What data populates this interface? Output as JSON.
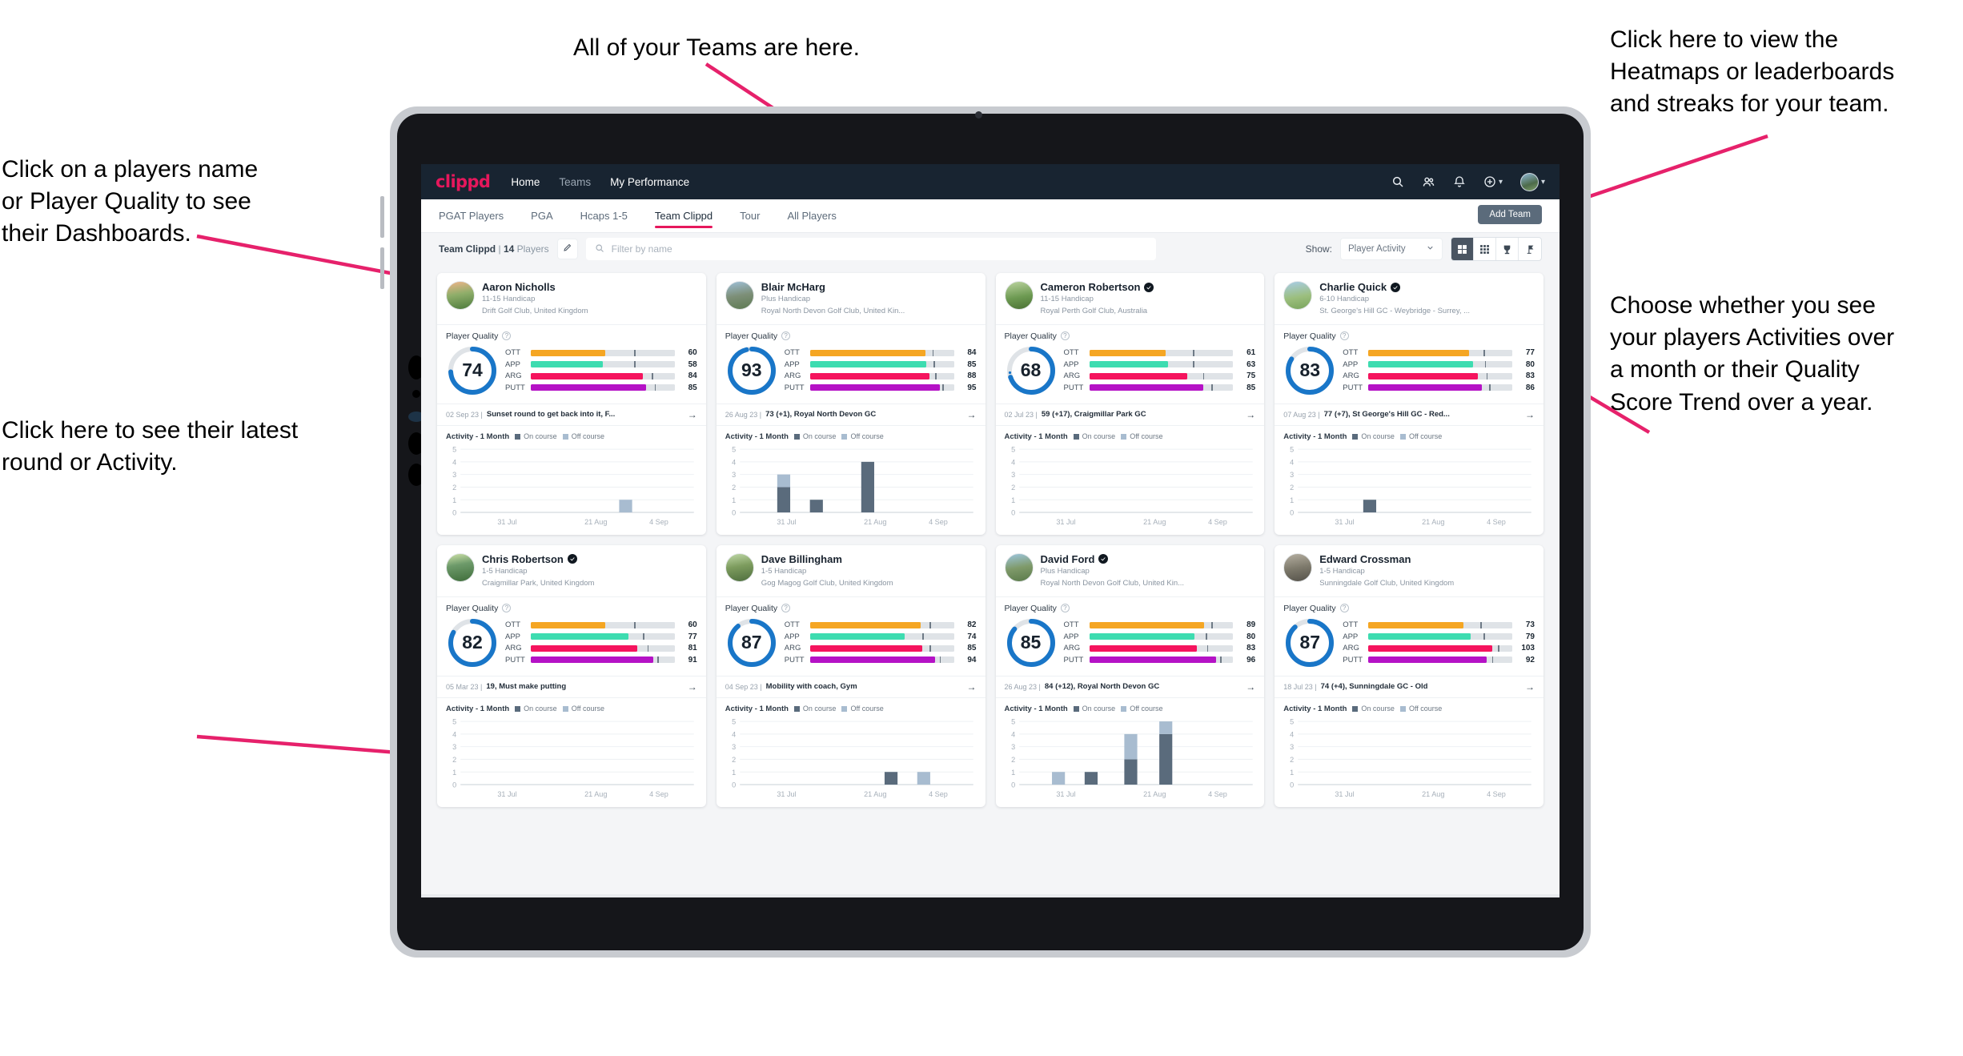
{
  "annotations": [
    {
      "id": "teams-callout",
      "text": "All of your Teams are here."
    },
    {
      "id": "heatmaps-callout",
      "text": "Click here to view the\nHeatmaps or leaderboards\nand streaks for your team."
    },
    {
      "id": "player-name-callout",
      "text": "Click on a players name\nor Player Quality to see\ntheir Dashboards."
    },
    {
      "id": "activity-toggle-callout",
      "text": "Choose whether you see\nyour players Activities over\na month or their Quality\nScore Trend over a year."
    },
    {
      "id": "latest-round-callout",
      "text": "Click here to see their latest\nround or Activity."
    }
  ],
  "app": {
    "brand": "clippd",
    "nav_links": [
      {
        "label": "Home",
        "active": true
      },
      {
        "label": "Teams",
        "active": false
      },
      {
        "label": "My Performance",
        "active": true
      }
    ],
    "nav_icons": [
      "search-icon",
      "people-icon",
      "bell-icon",
      "plus-circle-icon",
      "avatar"
    ],
    "tabs": [
      {
        "label": "PGAT Players",
        "active": false
      },
      {
        "label": "PGA",
        "active": false
      },
      {
        "label": "Hcaps 1-5",
        "active": false
      },
      {
        "label": "Team Clippd",
        "active": true
      },
      {
        "label": "Tour",
        "active": false
      },
      {
        "label": "All Players",
        "active": false
      }
    ],
    "add_team_label": "Add Team",
    "filter_bar": {
      "team_name": "Team Clippd",
      "separator": "|",
      "player_count": "14",
      "players_label": "Players",
      "edit_icon": "pencil-icon",
      "search_placeholder": "Filter by name",
      "show_label": "Show:",
      "select_value": "Player Activity",
      "view_buttons": [
        "grid-large-icon",
        "grid-small-icon",
        "trophy-icon",
        "flag-icon"
      ]
    },
    "card_labels": {
      "player_quality": "Player Quality",
      "activity_title": "Activity - 1 Month",
      "legend_on": "On course",
      "legend_off": "Off course"
    },
    "colors": {
      "brand_pink": "#e6175c",
      "navbar": "#182431",
      "ring": "#1976c8",
      "ott": "#f5a623",
      "app": "#3ddcb0",
      "arg": "#f5145e",
      "putt": "#b512c6",
      "on_course": "#5a6b7c",
      "off_course": "#a8bcd0"
    }
  },
  "chart_data": {
    "type": "bar",
    "title": "Activity - 1 Month",
    "ylabel": "",
    "xlabel": "",
    "ylim": [
      0,
      5
    ],
    "yticks": [
      0,
      1,
      2,
      3,
      4,
      5
    ],
    "categories": [
      "31 Jul",
      "21 Aug",
      "4 Sep"
    ],
    "legend": [
      "On course",
      "Off course"
    ],
    "legend_position": "top",
    "grid": true,
    "series_note": "Each player card shows a stacked bar chart of weekly activity counts"
  },
  "players": [
    {
      "name": "Aaron Nicholls",
      "verified": false,
      "handicap": "11-15 Handicap",
      "club": "Drift Golf Club, United Kingdom",
      "quality": "74",
      "ring_pct": 74,
      "metrics": [
        {
          "label": "OTT",
          "value": "60",
          "fill": 52,
          "tick": 72
        },
        {
          "label": "APP",
          "value": "58",
          "fill": 50,
          "tick": 72
        },
        {
          "label": "ARG",
          "value": "84",
          "fill": 78,
          "tick": 84
        },
        {
          "label": "PUTT",
          "value": "85",
          "fill": 80,
          "tick": 86
        }
      ],
      "round_date": "02 Sep 23",
      "round_text": "Sunset round to get back into it, F...",
      "bars": [
        {
          "x": 68,
          "on": 0,
          "off": 1
        }
      ]
    },
    {
      "name": "Blair McHarg",
      "verified": false,
      "handicap": "Plus Handicap",
      "club": "Royal North Devon Golf Club, United Kin...",
      "quality": "93",
      "ring_pct": 96,
      "metrics": [
        {
          "label": "OTT",
          "value": "84",
          "fill": 80,
          "tick": 85
        },
        {
          "label": "APP",
          "value": "85",
          "fill": 81,
          "tick": 86
        },
        {
          "label": "ARG",
          "value": "88",
          "fill": 83,
          "tick": 87
        },
        {
          "label": "PUTT",
          "value": "95",
          "fill": 90,
          "tick": 92
        }
      ],
      "round_date": "26 Aug 23",
      "round_text": "73 (+1), Royal North Devon GC",
      "bars": [
        {
          "x": 16,
          "on": 2,
          "off": 1
        },
        {
          "x": 30,
          "on": 1,
          "off": 0
        },
        {
          "x": 52,
          "on": 4,
          "off": 0
        }
      ]
    },
    {
      "name": "Cameron Robertson",
      "verified": true,
      "handicap": "11-15 Handicap",
      "club": "Royal Perth Golf Club, Australia",
      "quality": "68",
      "ring_pct": 70,
      "metrics": [
        {
          "label": "OTT",
          "value": "61",
          "fill": 53,
          "tick": 72
        },
        {
          "label": "APP",
          "value": "63",
          "fill": 55,
          "tick": 72
        },
        {
          "label": "ARG",
          "value": "75",
          "fill": 68,
          "tick": 79
        },
        {
          "label": "PUTT",
          "value": "85",
          "fill": 79,
          "tick": 85
        }
      ],
      "round_date": "02 Jul 23",
      "round_text": "59 (+17), Craigmillar Park GC",
      "bars": []
    },
    {
      "name": "Charlie Quick",
      "verified": true,
      "handicap": "6-10 Handicap",
      "club": "St. George's Hill GC - Weybridge - Surrey, ...",
      "quality": "83",
      "ring_pct": 84,
      "metrics": [
        {
          "label": "OTT",
          "value": "77",
          "fill": 70,
          "tick": 80
        },
        {
          "label": "APP",
          "value": "80",
          "fill": 73,
          "tick": 81
        },
        {
          "label": "ARG",
          "value": "83",
          "fill": 76,
          "tick": 82
        },
        {
          "label": "PUTT",
          "value": "86",
          "fill": 79,
          "tick": 84
        }
      ],
      "round_date": "07 Aug 23",
      "round_text": "77 (+7), St George's Hill GC - Red...",
      "bars": [
        {
          "x": 28,
          "on": 1,
          "off": 0
        }
      ]
    },
    {
      "name": "Chris Robertson",
      "verified": true,
      "handicap": "1-5 Handicap",
      "club": "Craigmillar Park, United Kingdom",
      "quality": "82",
      "ring_pct": 83,
      "metrics": [
        {
          "label": "OTT",
          "value": "60",
          "fill": 52,
          "tick": 72
        },
        {
          "label": "APP",
          "value": "77",
          "fill": 68,
          "tick": 78
        },
        {
          "label": "ARG",
          "value": "81",
          "fill": 74,
          "tick": 81
        },
        {
          "label": "PUTT",
          "value": "91",
          "fill": 85,
          "tick": 88
        }
      ],
      "round_date": "05 Mar 23",
      "round_text": "19, Must make putting",
      "bars": []
    },
    {
      "name": "Dave Billingham",
      "verified": false,
      "handicap": "1-5 Handicap",
      "club": "Gog Magog Golf Club, United Kingdom",
      "quality": "87",
      "ring_pct": 89,
      "metrics": [
        {
          "label": "OTT",
          "value": "82",
          "fill": 77,
          "tick": 83
        },
        {
          "label": "APP",
          "value": "74",
          "fill": 66,
          "tick": 78
        },
        {
          "label": "ARG",
          "value": "85",
          "fill": 78,
          "tick": 83
        },
        {
          "label": "PUTT",
          "value": "94",
          "fill": 87,
          "tick": 90
        }
      ],
      "round_date": "04 Sep 23",
      "round_text": "Mobility with coach, Gym",
      "bars": [
        {
          "x": 62,
          "on": 1,
          "off": 0
        },
        {
          "x": 76,
          "on": 0,
          "off": 1
        }
      ]
    },
    {
      "name": "David Ford",
      "verified": true,
      "handicap": "Plus Handicap",
      "club": "Royal North Devon Golf Club, United Kin...",
      "quality": "85",
      "ring_pct": 86,
      "metrics": [
        {
          "label": "OTT",
          "value": "89",
          "fill": 80,
          "tick": 85
        },
        {
          "label": "APP",
          "value": "80",
          "fill": 73,
          "tick": 81
        },
        {
          "label": "ARG",
          "value": "83",
          "fill": 75,
          "tick": 82
        },
        {
          "label": "PUTT",
          "value": "96",
          "fill": 88,
          "tick": 91
        }
      ],
      "round_date": "26 Aug 23",
      "round_text": "84 (+12), Royal North Devon GC",
      "bars": [
        {
          "x": 14,
          "on": 0,
          "off": 1
        },
        {
          "x": 28,
          "on": 1,
          "off": 0
        },
        {
          "x": 45,
          "on": 2,
          "off": 2
        },
        {
          "x": 60,
          "on": 4,
          "off": 1
        }
      ]
    },
    {
      "name": "Edward Crossman",
      "verified": false,
      "handicap": "1-5 Handicap",
      "club": "Sunningdale Golf Club, United Kingdom",
      "quality": "87",
      "ring_pct": 88,
      "metrics": [
        {
          "label": "OTT",
          "value": "73",
          "fill": 66,
          "tick": 78
        },
        {
          "label": "APP",
          "value": "79",
          "fill": 71,
          "tick": 80
        },
        {
          "label": "ARG",
          "value": "103",
          "fill": 86,
          "tick": 90
        },
        {
          "label": "PUTT",
          "value": "92",
          "fill": 82,
          "tick": 86
        }
      ],
      "round_date": "18 Jul 23",
      "round_text": "74 (+4), Sunningdale GC - Old",
      "bars": []
    }
  ]
}
